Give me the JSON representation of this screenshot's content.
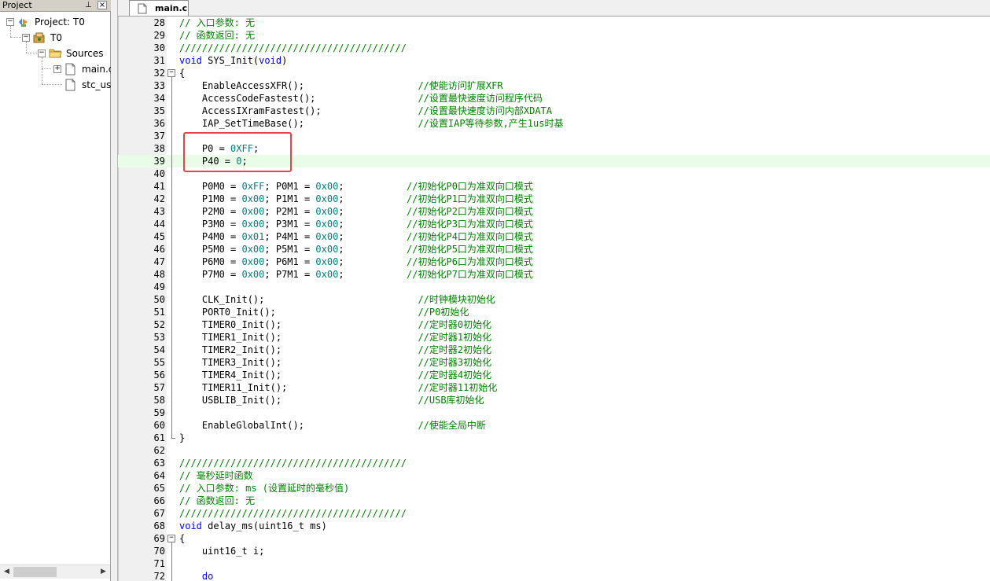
{
  "project_panel": {
    "title": "Project",
    "pin": "⊥",
    "close": "×",
    "tree": [
      {
        "label": "Project: T0",
        "icon": "project-icon",
        "toggle": "−"
      },
      {
        "label": "T0",
        "icon": "target-icon",
        "toggle": "−"
      },
      {
        "label": "Sources",
        "icon": "folder-icon",
        "toggle": "−"
      },
      {
        "label": "main.c",
        "icon": "file-icon",
        "toggle": "+"
      },
      {
        "label": "stc_usb",
        "icon": "file-icon",
        "toggle": ""
      }
    ],
    "scroll_left": "◀",
    "scroll_right": "▶"
  },
  "tab": {
    "label": "main.c",
    "icon": "document-icon"
  },
  "code": [
    {
      "n": "28",
      "f": "",
      "s": [
        [
          "c",
          "// 入口参数: 无"
        ]
      ]
    },
    {
      "n": "29",
      "f": "",
      "s": [
        [
          "c",
          "// 函数返回: 无"
        ]
      ]
    },
    {
      "n": "30",
      "f": "",
      "s": [
        [
          "c",
          "////////////////////////////////////////"
        ]
      ]
    },
    {
      "n": "31",
      "f": "",
      "s": [
        [
          "k",
          "void"
        ],
        [
          "",
          " SYS_Init("
        ],
        [
          "k",
          "void"
        ],
        [
          "",
          ")"
        ]
      ]
    },
    {
      "n": "32",
      "f": "open",
      "s": [
        [
          "",
          "{"
        ]
      ]
    },
    {
      "n": "33",
      "f": "line",
      "s": [
        [
          "",
          "    EnableAccessXFR();                    "
        ],
        [
          "c",
          "//使能访问扩展XFR"
        ]
      ]
    },
    {
      "n": "34",
      "f": "line",
      "s": [
        [
          "",
          "    AccessCodeFastest();                  "
        ],
        [
          "c",
          "//设置最快速度访问程序代码"
        ]
      ]
    },
    {
      "n": "35",
      "f": "line",
      "s": [
        [
          "",
          "    AccessIXramFastest();                 "
        ],
        [
          "c",
          "//设置最快速度访问内部XDATA"
        ]
      ]
    },
    {
      "n": "36",
      "f": "line",
      "s": [
        [
          "",
          "    IAP_SetTimeBase();                    "
        ],
        [
          "c",
          "//设置IAP等待参数,产生1us时基"
        ]
      ]
    },
    {
      "n": "37",
      "f": "line",
      "s": [
        [
          "",
          ""
        ]
      ]
    },
    {
      "n": "38",
      "f": "line",
      "s": [
        [
          "",
          "    P0 = "
        ],
        [
          "n",
          "0XFF"
        ],
        [
          "",
          ";"
        ]
      ]
    },
    {
      "n": "39",
      "f": "line",
      "hl": true,
      "s": [
        [
          "",
          "    P40 = "
        ],
        [
          "n",
          "0"
        ],
        [
          "",
          ";"
        ]
      ]
    },
    {
      "n": "40",
      "f": "line",
      "s": [
        [
          "",
          ""
        ]
      ]
    },
    {
      "n": "41",
      "f": "line",
      "s": [
        [
          "",
          "    P0M0 = "
        ],
        [
          "n",
          "0xFF"
        ],
        [
          "",
          "; P0M1 = "
        ],
        [
          "n",
          "0x00"
        ],
        [
          "",
          ";           "
        ],
        [
          "c",
          "//初始化P0口为准双向口模式"
        ]
      ]
    },
    {
      "n": "42",
      "f": "line",
      "s": [
        [
          "",
          "    P1M0 = "
        ],
        [
          "n",
          "0x00"
        ],
        [
          "",
          "; P1M1 = "
        ],
        [
          "n",
          "0x00"
        ],
        [
          "",
          ";           "
        ],
        [
          "c",
          "//初始化P1口为准双向口模式"
        ]
      ]
    },
    {
      "n": "43",
      "f": "line",
      "s": [
        [
          "",
          "    P2M0 = "
        ],
        [
          "n",
          "0x00"
        ],
        [
          "",
          "; P2M1 = "
        ],
        [
          "n",
          "0x00"
        ],
        [
          "",
          ";           "
        ],
        [
          "c",
          "//初始化P2口为准双向口模式"
        ]
      ]
    },
    {
      "n": "44",
      "f": "line",
      "s": [
        [
          "",
          "    P3M0 = "
        ],
        [
          "n",
          "0x00"
        ],
        [
          "",
          "; P3M1 = "
        ],
        [
          "n",
          "0x00"
        ],
        [
          "",
          ";           "
        ],
        [
          "c",
          "//初始化P3口为准双向口模式"
        ]
      ]
    },
    {
      "n": "45",
      "f": "line",
      "s": [
        [
          "",
          "    P4M0 = "
        ],
        [
          "n",
          "0x01"
        ],
        [
          "",
          "; P4M1 = "
        ],
        [
          "n",
          "0x00"
        ],
        [
          "",
          ";           "
        ],
        [
          "c",
          "//初始化P4口为准双向口模式"
        ]
      ]
    },
    {
      "n": "46",
      "f": "line",
      "s": [
        [
          "",
          "    P5M0 = "
        ],
        [
          "n",
          "0x00"
        ],
        [
          "",
          "; P5M1 = "
        ],
        [
          "n",
          "0x00"
        ],
        [
          "",
          ";           "
        ],
        [
          "c",
          "//初始化P5口为准双向口模式"
        ]
      ]
    },
    {
      "n": "47",
      "f": "line",
      "s": [
        [
          "",
          "    P6M0 = "
        ],
        [
          "n",
          "0x00"
        ],
        [
          "",
          "; P6M1 = "
        ],
        [
          "n",
          "0x00"
        ],
        [
          "",
          ";           "
        ],
        [
          "c",
          "//初始化P6口为准双向口模式"
        ]
      ]
    },
    {
      "n": "48",
      "f": "line",
      "s": [
        [
          "",
          "    P7M0 = "
        ],
        [
          "n",
          "0x00"
        ],
        [
          "",
          "; P7M1 = "
        ],
        [
          "n",
          "0x00"
        ],
        [
          "",
          ";           "
        ],
        [
          "c",
          "//初始化P7口为准双向口模式"
        ]
      ]
    },
    {
      "n": "49",
      "f": "line",
      "s": [
        [
          "",
          ""
        ]
      ]
    },
    {
      "n": "50",
      "f": "line",
      "s": [
        [
          "",
          "    CLK_Init();                           "
        ],
        [
          "c",
          "//时钟模块初始化"
        ]
      ]
    },
    {
      "n": "51",
      "f": "line",
      "s": [
        [
          "",
          "    PORT0_Init();                         "
        ],
        [
          "c",
          "//P0初始化"
        ]
      ]
    },
    {
      "n": "52",
      "f": "line",
      "s": [
        [
          "",
          "    TIMER0_Init();                        "
        ],
        [
          "c",
          "//定时器0初始化"
        ]
      ]
    },
    {
      "n": "53",
      "f": "line",
      "s": [
        [
          "",
          "    TIMER1_Init();                        "
        ],
        [
          "c",
          "//定时器1初始化"
        ]
      ]
    },
    {
      "n": "54",
      "f": "line",
      "s": [
        [
          "",
          "    TIMER2_Init();                        "
        ],
        [
          "c",
          "//定时器2初始化"
        ]
      ]
    },
    {
      "n": "55",
      "f": "line",
      "s": [
        [
          "",
          "    TIMER3_Init();                        "
        ],
        [
          "c",
          "//定时器3初始化"
        ]
      ]
    },
    {
      "n": "56",
      "f": "line",
      "s": [
        [
          "",
          "    TIMER4_Init();                        "
        ],
        [
          "c",
          "//定时器4初始化"
        ]
      ]
    },
    {
      "n": "57",
      "f": "line",
      "s": [
        [
          "",
          "    TIMER11_Init();                       "
        ],
        [
          "c",
          "//定时器11初始化"
        ]
      ]
    },
    {
      "n": "58",
      "f": "line",
      "s": [
        [
          "",
          "    USBLIB_Init();                        "
        ],
        [
          "c",
          "//USB库初始化"
        ]
      ]
    },
    {
      "n": "59",
      "f": "line",
      "s": [
        [
          "",
          ""
        ]
      ]
    },
    {
      "n": "60",
      "f": "line",
      "s": [
        [
          "",
          "    EnableGlobalInt();                    "
        ],
        [
          "c",
          "//使能全局中断"
        ]
      ]
    },
    {
      "n": "61",
      "f": "end",
      "s": [
        [
          "",
          "}"
        ]
      ]
    },
    {
      "n": "62",
      "f": "",
      "s": [
        [
          "",
          ""
        ]
      ]
    },
    {
      "n": "63",
      "f": "",
      "s": [
        [
          "c",
          "////////////////////////////////////////"
        ]
      ]
    },
    {
      "n": "64",
      "f": "",
      "s": [
        [
          "c",
          "// 毫秒延时函数"
        ]
      ]
    },
    {
      "n": "65",
      "f": "",
      "s": [
        [
          "c",
          "// 入口参数: ms (设置延时的毫秒值)"
        ]
      ]
    },
    {
      "n": "66",
      "f": "",
      "s": [
        [
          "c",
          "// 函数返回: 无"
        ]
      ]
    },
    {
      "n": "67",
      "f": "",
      "s": [
        [
          "c",
          "////////////////////////////////////////"
        ]
      ]
    },
    {
      "n": "68",
      "f": "",
      "s": [
        [
          "k",
          "void"
        ],
        [
          "",
          " delay_ms(uint16_t ms)"
        ]
      ]
    },
    {
      "n": "69",
      "f": "open",
      "s": [
        [
          "",
          "{"
        ]
      ]
    },
    {
      "n": "70",
      "f": "line",
      "s": [
        [
          "",
          "    uint16_t i;"
        ]
      ]
    },
    {
      "n": "71",
      "f": "line",
      "s": [
        [
          "",
          ""
        ]
      ]
    },
    {
      "n": "72",
      "f": "line",
      "s": [
        [
          "",
          "    "
        ],
        [
          "k",
          "do"
        ]
      ]
    }
  ]
}
